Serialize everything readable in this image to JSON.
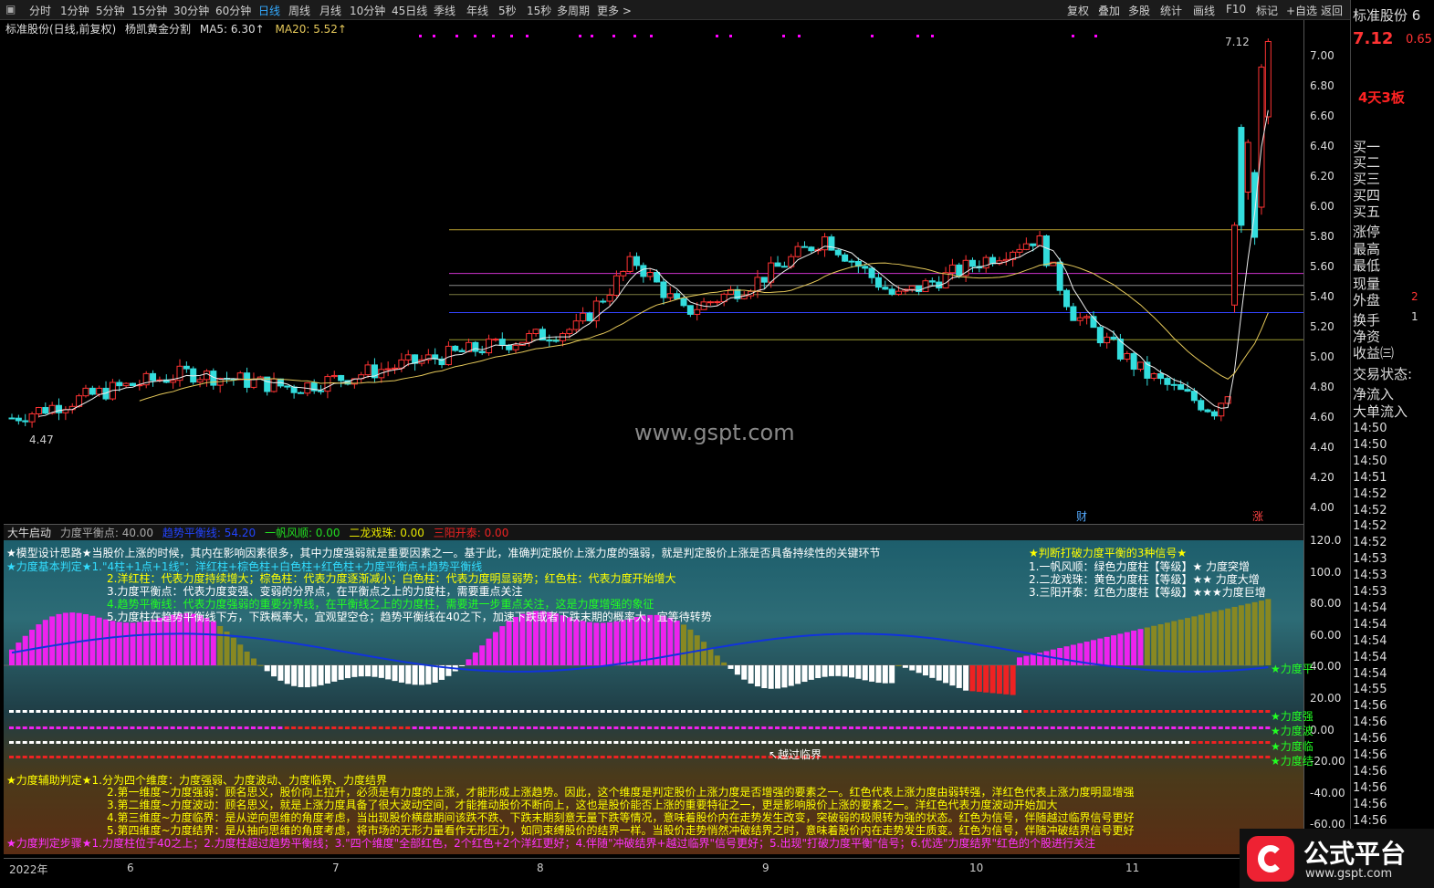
{
  "toolbar": {
    "left": [
      "分时",
      "1分钟",
      "5分钟",
      "15分钟",
      "30分钟",
      "60分钟",
      "日线",
      "周线",
      "月线",
      "10分钟",
      "45日线",
      "季线",
      "年线",
      "5秒",
      "15秒",
      "多周期",
      "更多 >"
    ],
    "right": [
      "复权",
      "叠加",
      "多股",
      "统计",
      "画线",
      "F10",
      "标记",
      "+自选",
      "返回"
    ],
    "active": "日线"
  },
  "header": {
    "stock": "标准股份(日线,前复权)",
    "formula": "杨凯黄金分割",
    "ma5": "MA5: 6.30↑",
    "ma20": "MA20: 5.52↑"
  },
  "price_axis": [
    "7.00",
    "6.80",
    "6.60",
    "6.40",
    "6.20",
    "6.00",
    "5.80",
    "5.60",
    "5.40",
    "5.20",
    "5.00",
    "4.80",
    "4.60",
    "4.40",
    "4.20",
    "4.00"
  ],
  "labels": {
    "high": "7.12",
    "low": "4.47",
    "cai": "财",
    "zhang": "涨",
    "watermark": "www.gspt.com"
  },
  "indicator_header": {
    "name": "大牛启动",
    "f1": "力度平衡点: 40.00",
    "f2": "趋势平衡线: 54.20",
    "f3": "一帆风顺: 0.00",
    "f4": "二龙戏珠: 0.00",
    "f5": "三阳开泰: 0.00"
  },
  "ind_axis": [
    "120.0",
    "100.0",
    "80.00",
    "60.00",
    "40.00",
    "20.00",
    "0.00",
    "-20.00",
    "-40.00",
    "-60.00"
  ],
  "ind_text": {
    "l1": "★模型设计思路★当股价上涨的时候，其内在影响因素很多，其中力度强弱就是重要因素之一。基于此，准确判定股价上涨力度的强弱，就是判定股价上涨是否具备持续性的关键环节",
    "l2": "★力度基本判定★1.\"4柱+1点+1线\"：洋红柱+棕色柱+白色柱+红色柱+力度平衡点+趋势平衡线",
    "l3": "2.洋红柱：代表力度持续增大；棕色柱：代表力度逐渐减小；白色柱：代表力度明显弱势；红色柱：代表力度开始增大",
    "l4": "3.力度平衡点：代表力度变强、变弱的分界点，在平衡点之上的力度柱，需要重点关注",
    "l5": "4.趋势平衡线：代表力度强弱的重要分界线，在平衡线之上的力度柱，需要进一步重点关注，这是力度增强的象征",
    "l6": "5.力度柱在趋势平衡线下方，下跌概率大，宜观望空仓；趋势平衡线在40之下，加速下跌或者下跌末期的概率大，宜等待转势",
    "r0": "★判断打破力度平衡的3种信号★",
    "r1": "1.一帆风顺：绿色力度柱【等级】★    力度突增",
    "r2": "2.二龙戏珠：黄色力度柱【等级】★★  力度大增",
    "r3": "3.三阳开泰：红色力度柱【等级】★★★力度巨增",
    "yue": "↖越过临界",
    "b0": "★力度辅助判定★1.分为四个维度：力度强弱、力度波动、力度临界、力度结界",
    "b1": "2.第一维度~力度强弱：顾名思义，股价向上拉升，必须是有力度的上涨，才能形成上涨趋势。因此，这个维度是判定股价上涨力度是否增强的要素之一。红色代表上涨力度由弱转强，洋红色代表上涨力度明显增强",
    "b2": "3.第二维度~力度波动：顾名思义，就是上涨力度具备了很大波动空间，才能推动股价不断向上，这也是股价能否上涨的重要特征之一，更是影响股价上涨的要素之一。洋红色代表力度波动开始加大",
    "b3": "4.第三维度~力度临界：是从逆向思维的角度考虑，当出现股价横盘期间该跌不跌、下跌末期刻意无量下跌等情况，意味着股价内在走势发生改变，突破弱的极限转为强的状态。红色为信号，伴随越过临界信号更好",
    "b4": "5.第四维度~力度结界：是从抽向思维的角度考虑，将市场的无形力量看作无形压力，如同束缚股价的结界一样。当股价走势悄然冲破结界之时，意味着股价内在走势发生质变。红色为信号，伴随冲破结界信号更好",
    "b5": "★力度判定步骤★1.力度柱位于40之上；2.力度柱超过趋势平衡线；3.\"四个维度\"全部红色，2个红色+2个洋红更好；4.伴随\"冲破结界+越过临界\"信号更好；5.出现\"打破力度平衡\"信号；6.优选\"力度结界\"红色的个股进行关注",
    "side1": "★力度平",
    "side2": "★力度强",
    "side3": "★力度波",
    "side4": "★力度临",
    "side5": "★力度结"
  },
  "dates": [
    "2022年",
    "6",
    "7",
    "8",
    "9",
    "10",
    "11"
  ],
  "rightpanel": {
    "name": "标准股份 6",
    "price": "7.12",
    "chg": "0.65",
    "tag": "4天3板",
    "rows": [
      "买一",
      "买二",
      "买三",
      "买四",
      "买五",
      "涨停",
      "最高",
      "最低",
      "现量",
      "外盘",
      "换手",
      "净资",
      "收益㈢",
      "交易状态:",
      "净流入",
      "大单流入"
    ],
    "outer_val": "2",
    "turn_val": "1",
    "times": [
      "14:50",
      "14:50",
      "14:50",
      "14:51",
      "14:52",
      "14:52",
      "14:52",
      "14:52",
      "14:53",
      "14:53",
      "14:53",
      "14:54",
      "14:54",
      "14:54",
      "14:54",
      "14:54",
      "14:55",
      "14:56",
      "14:56",
      "14:56",
      "14:56",
      "14:56",
      "14:56",
      "14:56",
      "14:56"
    ]
  },
  "logo": {
    "text": "公式平台",
    "url": "www.gspt.com"
  }
}
